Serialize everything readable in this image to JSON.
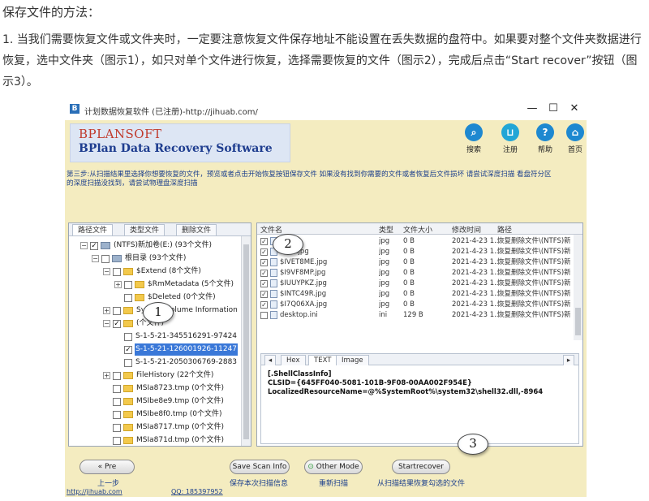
{
  "article": {
    "title": "保存文件的方法：",
    "paragraph": "1. 当我们需要恢复文件或文件夹时，一定要注意恢复文件保存地址不能设置在丢失数据的盘符中。如果要对整个文件夹数据进行恢复，选中文件夹（图示1），如只对单个文件进行恢复，选择需要恢复的文件（图示2），完成后点击“Start recover”按钮（图示3）。"
  },
  "window": {
    "icon_letter": "B",
    "title": "计划数据恢复软件 (已注册)-http://jihuab.com/",
    "controls": [
      "—",
      "☐",
      "✕"
    ]
  },
  "header": {
    "logo_line1": "BPLANSOFT",
    "logo_line2": "BPlan Data Recovery Software",
    "buttons": [
      {
        "label": "搜索",
        "icon": "search-icon",
        "color": "#1e88d0"
      },
      {
        "label": "注册",
        "icon": "cart-icon",
        "color": "#22a6d6"
      },
      {
        "label": "帮助",
        "icon": "help-icon",
        "color": "#1e88d0"
      },
      {
        "label": "首页",
        "icon": "home-icon",
        "color": "#1e88d0"
      }
    ]
  },
  "info_text": "第三步:从扫描结果里选择你想要恢复的文件，预览或者点击开始恢复按钮保存文件 如果没有找到你需要的文件或者恢复后文件损坏 请尝试深度扫描 看盘符分区的深度扫描没找到，请尝试物理盘深度扫描",
  "left_tabs": [
    "路径文件",
    "类型文件",
    "删除文件"
  ],
  "tree": [
    {
      "label": "(NTFS)新加卷(E:) (93个文件)",
      "level": 0,
      "exp": "⊟",
      "checked": true,
      "icon": "drive"
    },
    {
      "label": "根目录 (93个文件)",
      "level": 1,
      "exp": "⊟",
      "checked": false,
      "icon": "drive"
    },
    {
      "label": "$Extend (8个文件)",
      "level": 2,
      "exp": "⊟",
      "checked": false,
      "icon": "folder"
    },
    {
      "label": "$RmMetadata (5个文件)",
      "level": 3,
      "exp": "⊞",
      "checked": false,
      "icon": "folder"
    },
    {
      "label": "$Deleted (0个文件)",
      "level": 3,
      "exp": "",
      "checked": false,
      "icon": "folder"
    },
    {
      "label": "System Volume Information (5",
      "level": 2,
      "exp": "⊞",
      "checked": false,
      "icon": "folder"
    },
    {
      "label": "(个文件)",
      "level": 2,
      "exp": "⊟",
      "checked": true,
      "icon": "folder"
    },
    {
      "label": "S-1-5-21-345516291-97424",
      "level": 3,
      "exp": "",
      "checked": false,
      "icon": "none"
    },
    {
      "label": "S-1-5-21-126001926-11247",
      "level": 3,
      "exp": "",
      "checked": true,
      "icon": "none",
      "selected": true
    },
    {
      "label": "S-1-5-21-2050306769-2883",
      "level": 3,
      "exp": "",
      "checked": false,
      "icon": "none"
    },
    {
      "label": "FileHistory (22个文件)",
      "level": 2,
      "exp": "⊞",
      "checked": false,
      "icon": "folder"
    },
    {
      "label": "MSIa8723.tmp (0个文件)",
      "level": 2,
      "exp": "",
      "checked": false,
      "icon": "folder"
    },
    {
      "label": "MSIbe8e9.tmp (0个文件)",
      "level": 2,
      "exp": "",
      "checked": false,
      "icon": "folder"
    },
    {
      "label": "MSIbe8f0.tmp (0个文件)",
      "level": 2,
      "exp": "",
      "checked": false,
      "icon": "folder"
    },
    {
      "label": "MSIa8717.tmp (0个文件)",
      "level": 2,
      "exp": "",
      "checked": false,
      "icon": "folder"
    },
    {
      "label": "MSIa871d.tmp (0个文件)",
      "level": 2,
      "exp": "",
      "checked": false,
      "icon": "folder"
    }
  ],
  "file_list": {
    "columns": [
      "文件名",
      "类型",
      "文件大小",
      "修改时间",
      "路径"
    ],
    "rows": [
      {
        "name": "jpg",
        "type": "jpg",
        "size": "0 B",
        "time": "2021-4-23 1...",
        "path": "恢复删除文件\\(NTFS)新",
        "checked": true
      },
      {
        "name": "...N4.jpg",
        "type": "jpg",
        "size": "0 B",
        "time": "2021-4-23 1...",
        "path": "恢复删除文件\\(NTFS)新",
        "checked": true
      },
      {
        "name": "$IVET8ME.jpg",
        "type": "jpg",
        "size": "0 B",
        "time": "2021-4-23 1...",
        "path": "恢复删除文件\\(NTFS)新",
        "checked": true
      },
      {
        "name": "$I9VF8MP.jpg",
        "type": "jpg",
        "size": "0 B",
        "time": "2021-4-23 1...",
        "path": "恢复删除文件\\(NTFS)新",
        "checked": true
      },
      {
        "name": "$IUUYPKZ.jpg",
        "type": "jpg",
        "size": "0 B",
        "time": "2021-4-23 1...",
        "path": "恢复删除文件\\(NTFS)新",
        "checked": true
      },
      {
        "name": "$INTC49R.jpg",
        "type": "jpg",
        "size": "0 B",
        "time": "2021-4-23 1...",
        "path": "恢复删除文件\\(NTFS)新",
        "checked": true
      },
      {
        "name": "$I7Q06XA.jpg",
        "type": "jpg",
        "size": "0 B",
        "time": "2021-4-23 1...",
        "path": "恢复删除文件\\(NTFS)新",
        "checked": true
      },
      {
        "name": "desktop.ini",
        "type": "ini",
        "size": "129 B",
        "time": "2021-4-23 1...",
        "path": "恢复删除文件\\(NTFS)新",
        "checked": false
      }
    ]
  },
  "preview": {
    "tabs": [
      "Hex",
      "TEXT",
      "Image"
    ],
    "lines": [
      "[.ShellClassInfo]",
      "CLSID={645FF040-5081-101B-9F08-00AA002F954E}",
      "LocalizedResourceName=@%SystemRoot%\\system32\\shell32.dll,-8964"
    ]
  },
  "bottom": {
    "pre_label": "Pre",
    "pre_caption": "上一步",
    "save_scan_label": "Save Scan Info",
    "save_scan_caption": "保存本次扫描信息",
    "other_mode_label": "Other Mode",
    "other_mode_caption": "重新扫描",
    "start_recover_label": "Startrecover",
    "start_recover_caption": "从扫描结果恢复勾选的文件",
    "link_site": "http://jihuab.com",
    "link_qq": "QQ: 185397952"
  },
  "callouts": [
    "1",
    "2",
    "3"
  ]
}
